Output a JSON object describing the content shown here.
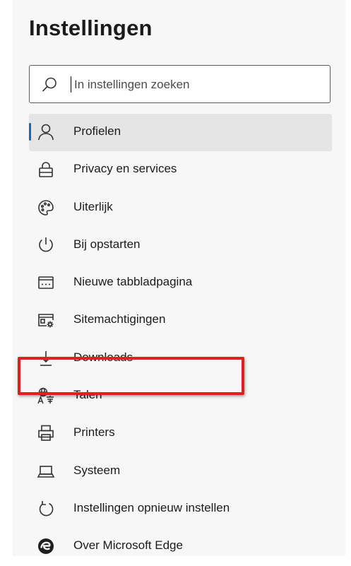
{
  "header": {
    "title": "Instellingen"
  },
  "search": {
    "placeholder": "In instellingen zoeken",
    "icon": "search-icon"
  },
  "nav": {
    "items": [
      {
        "label": "Profielen",
        "icon": "person-icon",
        "active": true
      },
      {
        "label": "Privacy en services",
        "icon": "lock-icon"
      },
      {
        "label": "Uiterlijk",
        "icon": "palette-icon"
      },
      {
        "label": "Bij opstarten",
        "icon": "power-icon"
      },
      {
        "label": "Nieuwe tabbladpagina",
        "icon": "new-tab-icon"
      },
      {
        "label": "Sitemachtigingen",
        "icon": "site-permissions-icon",
        "highlighted": true
      },
      {
        "label": "Downloads",
        "icon": "download-icon"
      },
      {
        "label": "Talen",
        "icon": "languages-icon"
      },
      {
        "label": "Printers",
        "icon": "printer-icon"
      },
      {
        "label": "Systeem",
        "icon": "laptop-icon"
      },
      {
        "label": "Instellingen opnieuw instellen",
        "icon": "reset-icon"
      },
      {
        "label": "Over Microsoft Edge",
        "icon": "edge-logo-icon"
      }
    ]
  },
  "colors": {
    "accent": "#0f6cbd",
    "highlight_box": "#e01f1f",
    "panel": "#f7f7f7",
    "active_item": "#e5e5e5"
  }
}
